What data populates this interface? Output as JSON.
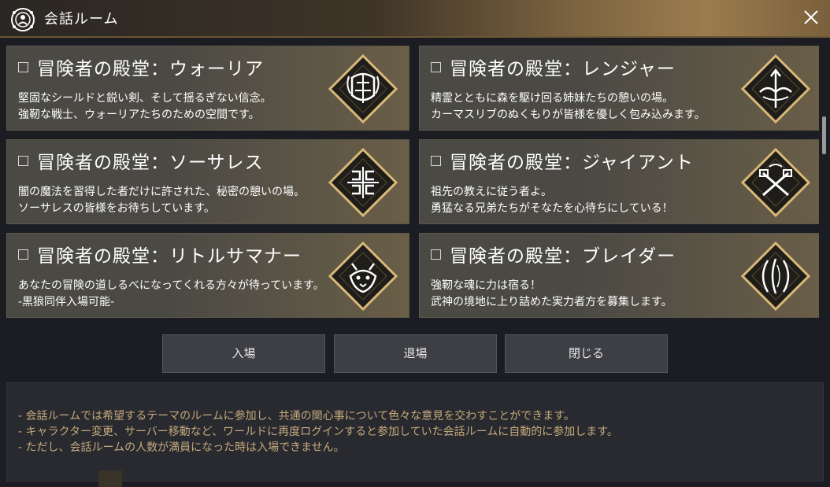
{
  "window": {
    "title": "会話ルーム",
    "logo_icon": "emblem-face-icon",
    "close_icon": "close-icon"
  },
  "rooms": [
    {
      "title": "冒険者の殿堂：ウォーリア",
      "desc1": "堅固なシールドと鋭い剣、そして揺るぎない信念。",
      "desc2": "強靭な戦士、ウォーリアたちのための空間です。",
      "icon": "warrior-emblem-icon"
    },
    {
      "title": "冒険者の殿堂：レンジャー",
      "desc1": "精霊とともに森を駆け回る姉妹たちの憩いの場。",
      "desc2": "カーマスリブのぬくもりが皆様を優しく包み込みます。",
      "icon": "ranger-emblem-icon"
    },
    {
      "title": "冒険者の殿堂：ソーサレス",
      "desc1": "闇の魔法を習得した者だけに許された、秘密の憩いの場。",
      "desc2": "ソーサレスの皆様をお待ちしています。",
      "icon": "sorceress-emblem-icon"
    },
    {
      "title": "冒険者の殿堂：ジャイアント",
      "desc1": "祖先の教えに従う者よ。",
      "desc2": "勇猛なる兄弟たちがそなたを心待ちにしている！",
      "icon": "giant-emblem-icon"
    },
    {
      "title": "冒険者の殿堂：リトルサマナー",
      "desc1": "あなたの冒険の道しるべになってくれる方々が待っています。",
      "desc2": "-黒狼同伴入場可能-",
      "icon": "little-summoner-emblem-icon"
    },
    {
      "title": "冒険者の殿堂：ブレイダー",
      "desc1": "強靭な魂に力は宿る！",
      "desc2": "武神の境地に上り詰めた実力者方を募集します。",
      "icon": "blader-emblem-icon"
    }
  ],
  "buttons": {
    "enter": "入場",
    "leave": "退場",
    "close": "閉じる"
  },
  "info": {
    "line1": "- 会話ルームでは希望するテーマのルームに参加し、共通の関心事について色々な意見を交わすことができます。",
    "line2": "- キャラクター変更、サーバー移動など、ワールドに再度ログインすると参加していた会話ルームに自動的に参加します。",
    "line3": "- ただし、会話ルームの人数が満員になった時は入場できません。"
  },
  "colors": {
    "accent_gold": "#c6a97a",
    "emblem_gold": "#d9b878",
    "panel_bg": "#1c1d22"
  }
}
